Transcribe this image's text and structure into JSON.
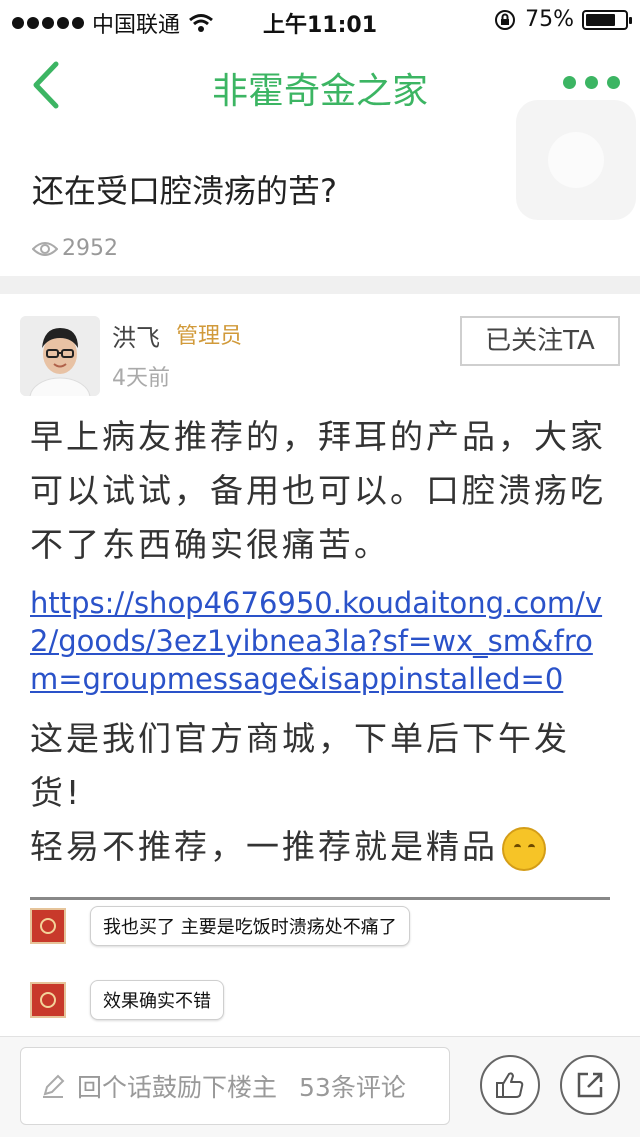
{
  "status_bar": {
    "carrier": "中国联通",
    "time": "上午11:01",
    "battery": "75%",
    "battery_level": 0.75
  },
  "nav": {
    "title": "非霍奇金之家"
  },
  "post": {
    "title": "还在受口腔溃疡的苦?",
    "views": "2952",
    "author": {
      "name": "洪飞",
      "role": "管理员",
      "time": "4天前",
      "follow_label": "已关注TA"
    },
    "paragraph1": "早上病友推荐的，拜耳的产品，大家可以试试，备用也可以。口腔溃疡吃不了东西确实很痛苦。",
    "link": "https://shop4676950.koudaitong.com/v2/goods/3ez1yibnea3la?sf=wx_sm&from=groupmessage&isappinstalled=0",
    "paragraph2_line1": "这是我们官方商城，下单后下午发货!",
    "paragraph2_line2": "轻易不推荐，一推荐就是精品",
    "emoji": "thinking-face",
    "screenshot_messages": [
      {
        "text": "我也买了 主要是吃饭时溃疡处不痛了"
      },
      {
        "text": "效果确实不错"
      }
    ]
  },
  "bottom_bar": {
    "comment_placeholder": "回个话鼓励下楼主",
    "comment_count": "53条评论"
  },
  "colors": {
    "accent": "#3cb563",
    "link": "#2a52c9",
    "admin": "#d19a3a"
  }
}
